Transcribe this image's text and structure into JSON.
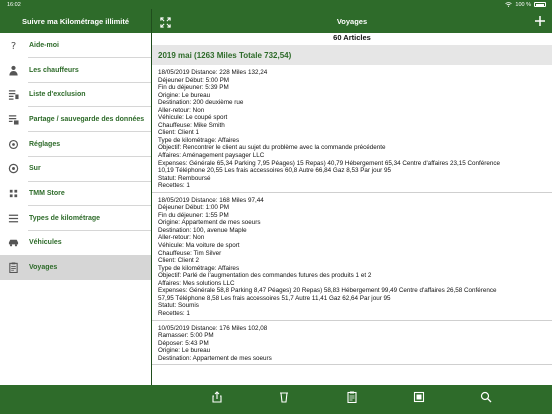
{
  "status_bar": {
    "time": "16:02",
    "battery": "100 %"
  },
  "sidebar": {
    "title": "Suivre ma Kilométrage illimité",
    "items": [
      {
        "label": "Aide-moi",
        "icon": "help-icon"
      },
      {
        "label": "Les chauffeurs",
        "icon": "person-icon"
      },
      {
        "label": "Liste d'exclusion",
        "icon": "exclusion-list-icon"
      },
      {
        "label": "Partage / sauvegarde des données",
        "icon": "share-backup-icon"
      },
      {
        "label": "Réglages",
        "icon": "settings-icon"
      },
      {
        "label": "Sur",
        "icon": "info-icon"
      },
      {
        "label": "TMM Store",
        "icon": "store-icon"
      },
      {
        "label": "Types de kilométrage",
        "icon": "list-icon"
      },
      {
        "label": "Véhicules",
        "icon": "car-icon"
      },
      {
        "label": "Voyages",
        "icon": "clipboard-icon",
        "active": true
      }
    ]
  },
  "header": {
    "title": "Voyages"
  },
  "content": {
    "count": "60 Articles",
    "month_header": "2019 mai (1263 Miles Totale 732,54)",
    "trips": [
      {
        "lines": [
          "18/05/2019 Distance: 228 Miles 132,24",
          "Déjeuner Début: 5:00 PM",
          "Fin du déjeuner: 5:39 PM",
          "Origine: Le bureau",
          "Destination: 200 deuxième rue",
          "Aller-retour: Non",
          "Véhicule: Le coupé sport",
          "Chauffeuse: Mike Smith",
          "Client: Client 1",
          "Type de kilométrage: Affaires",
          "Objectif: Rencontrer le client au sujet du problème avec la commande précédente",
          "Affaires: Aménagement paysager LLC",
          "Expenses: Générale 65,34 Parking 7,95 Péages) 15 Repas) 40,79 Hébergement 65,34 Centre d'affaires 23,15 Conférence",
          "10,19 Téléphone 20,55 Les frais accessoires 60,8 Autre 66,84 Gaz 8,53 Par jour 95",
          "Statut: Remboursé",
          "Recettes: 1"
        ]
      },
      {
        "lines": [
          "18/05/2019 Distance: 168 Miles 97,44",
          "Déjeuner Début: 1:00 PM",
          "Fin du déjeuner: 1:55 PM",
          "Origine: Appartement de mes soeurs",
          "Destination: 100, avenue Maple",
          "Aller-retour: Non",
          "Véhicule: Ma voiture de sport",
          "Chauffeuse: Tim Silver",
          "Client: Client 2",
          "Type de kilométrage: Affaires",
          "Objectif: Parlé de l'augmentation des commandes futures des produits 1 et 2",
          "Affaires: Mes solutions LLC",
          "Expenses: Générale 58,8 Parking 8,47 Péages) 20 Repas) 58,83 Hébergement 99,49 Centre d'affaires 26,58 Conférence",
          "57,95 Téléphone 8,58 Les frais accessoires 51,7 Autre 11,41 Gaz 62,64 Par jour 95",
          "Statut: Soumis",
          "Recettes: 1"
        ]
      },
      {
        "lines": [
          "10/05/2019 Distance: 176 Miles 102,08",
          "Ramasser: 5:00 PM",
          "Déposer: 5:43 PM",
          "Origine: Le bureau",
          "Destination: Appartement de mes soeurs"
        ]
      }
    ]
  },
  "toolbar": {
    "buttons": [
      {
        "name": "share-button",
        "icon": "share-icon"
      },
      {
        "name": "delete-button",
        "icon": "trash-icon"
      },
      {
        "name": "report-button",
        "icon": "clipboard-icon"
      },
      {
        "name": "export-button",
        "icon": "spreadsheet-icon"
      },
      {
        "name": "search-button",
        "icon": "search-icon"
      }
    ]
  },
  "colors": {
    "brand_green": "#2e6b2a",
    "selected_row": "#d6d6d6",
    "section_bg": "#e6e6e6"
  }
}
